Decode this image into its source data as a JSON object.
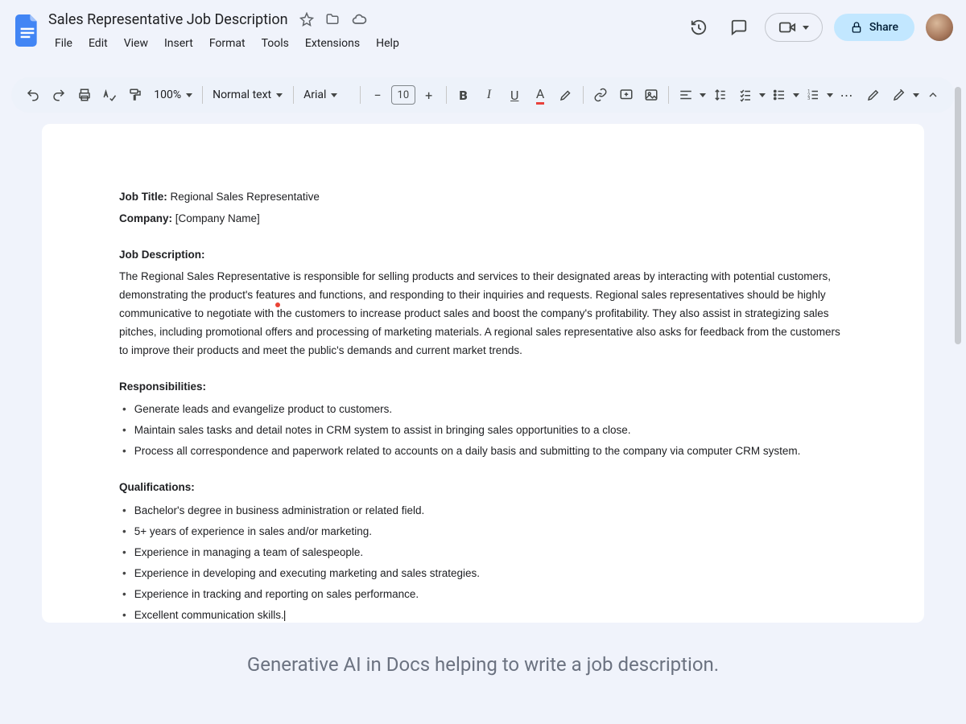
{
  "doc": {
    "title": "Sales Representative Job Description"
  },
  "menu": {
    "file": "File",
    "edit": "Edit",
    "view": "View",
    "insert": "Insert",
    "format": "Format",
    "tools": "Tools",
    "extensions": "Extensions",
    "help": "Help"
  },
  "actions": {
    "share": "Share"
  },
  "toolbar": {
    "zoom": "100%",
    "paragraph_style": "Normal text",
    "font": "Arial",
    "font_size": "10"
  },
  "content": {
    "job_title_label": "Job Title:",
    "job_title_value": " Regional Sales Representative",
    "company_label": "Company:",
    "company_value": " [Company Name]",
    "jd_heading": "Job Description:",
    "jd_body": "The Regional Sales Representative is responsible for selling products and services to their designated areas by interacting with potential customers, demonstrating the product's features and functions, and responding to their inquiries and requests. Regional sales representatives should be highly communicative to negotiate with the customers to increase product sales and boost the company's profitability. They also assist in strategizing sales pitches, including promotional offers and processing of marketing materials. A regional sales representative also asks for feedback from the customers to improve their products and meet the public's demands and current market trends.",
    "resp_heading": "Responsibilities:",
    "resp": [
      "Generate leads and evangelize product to customers.",
      "Maintain sales tasks and detail notes in CRM system to assist in bringing sales opportunities to a close.",
      "Process all correspondence and paperwork related to accounts on a daily basis and submitting to the company via computer CRM system."
    ],
    "qual_heading": "Qualifications:",
    "qual": [
      "Bachelor's degree in business administration or related field.",
      "5+ years of experience in sales and/or marketing.",
      "Experience in managing a team of salespeople.",
      "Experience in developing and executing marketing and sales strategies.",
      "Experience in tracking and reporting on sales performance.",
      "Excellent communication skills."
    ]
  },
  "caption": "Generative AI in Docs helping to write a job description."
}
